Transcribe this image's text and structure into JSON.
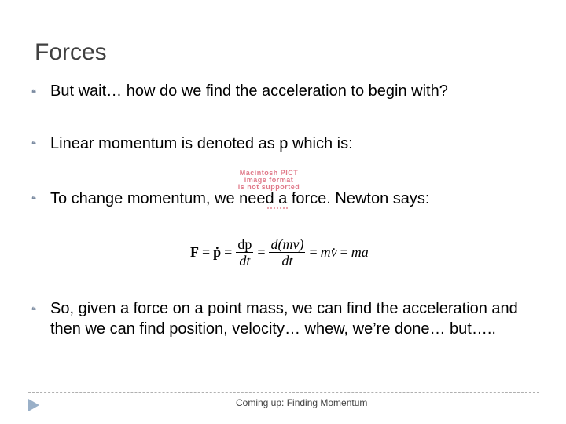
{
  "slide": {
    "title": "Forces",
    "bullets": [
      "But wait… how do we find the acceleration to begin with?",
      "Linear momentum is denoted as p which is:",
      "To change momentum, we need a force. Newton says:",
      "So, given a force on a point mass, we can find the acceleration and then we can find position, velocity… whew, we’re done… but….."
    ],
    "bullet_glyph": "❝",
    "pict_placeholder": {
      "line1": "Macintosh PICT",
      "line2": "image format",
      "line3": "is not supported"
    },
    "equation": {
      "lhs": "F",
      "pdot": "ṗ",
      "frac1_num": "dp",
      "frac1_den": "dt",
      "frac2_num": "d(mv)",
      "frac2_den": "dt",
      "mvdot": "mv̇",
      "ma": "ma",
      "equals": "="
    },
    "footer": "Coming up: Finding Momentum"
  },
  "colors": {
    "title": "#404040",
    "bullet": "#7a8aa0",
    "nav_arrow": "#9ab0c8",
    "pict_text": "#e07a8a"
  }
}
